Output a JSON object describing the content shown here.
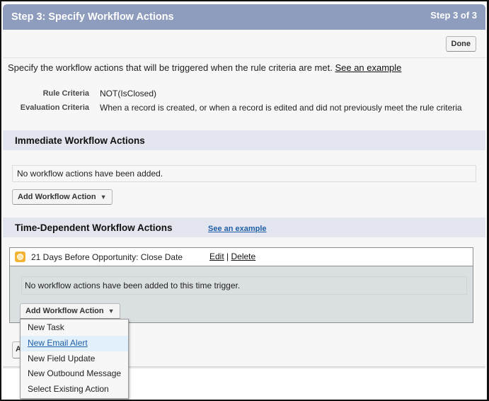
{
  "header": {
    "title": "Step 3: Specify Workflow Actions",
    "step_indicator": "Step 3 of 3"
  },
  "toolbar": {
    "done_label": "Done"
  },
  "intro": {
    "text": "Specify the workflow actions that will be triggered when the rule criteria are met.",
    "link": "See an example"
  },
  "criteria": [
    {
      "label": "Rule Criteria",
      "value": "NOT(IsClosed)"
    },
    {
      "label": "Evaluation Criteria",
      "value": "When a record is created, or when a record is edited and did not previously meet the rule criteria"
    }
  ],
  "immediate": {
    "heading": "Immediate Workflow Actions",
    "empty_text": "No workflow actions have been added.",
    "add_button": "Add Workflow Action",
    "arrow_icon": "▼"
  },
  "time_dependent": {
    "heading": "Time-Dependent Workflow Actions",
    "link": "See an example",
    "trigger": {
      "icon": "clock-icon",
      "title": "21 Days Before Opportunity: Close Date",
      "edit_label": "Edit",
      "separator": "|",
      "delete_label": "Delete",
      "empty_text": "No workflow actions have been added to this time trigger.",
      "add_button": "Add Workflow Action",
      "arrow_icon": "▼"
    },
    "add_time_trigger_partial": "A"
  },
  "dropdown": {
    "items": [
      {
        "label": "New Task"
      },
      {
        "label": "New Email Alert",
        "highlighted": true
      },
      {
        "label": "New Field Update"
      },
      {
        "label": "New Outbound Message"
      },
      {
        "label": "Select Existing Action"
      }
    ]
  },
  "colors": {
    "header_bg": "#8e9dbd",
    "section_bg": "#e3e6ee",
    "link_blue": "#1f5fa8",
    "trigger_body_bg": "#dadfe2",
    "dropdown_highlight": "#e1f0fb",
    "clock_orange": "#f2b233"
  }
}
